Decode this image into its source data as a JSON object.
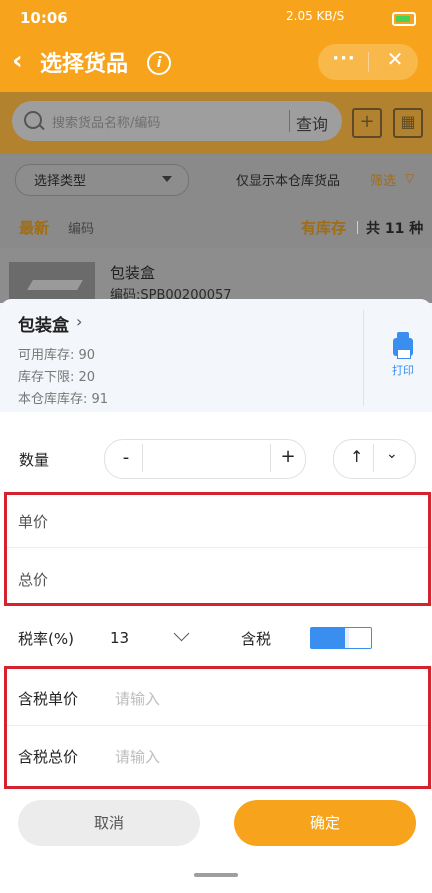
{
  "status_bar": {
    "time": "10:06",
    "network": "2.05 KB/S"
  },
  "header": {
    "title": "选择货品",
    "back_icon": "chevron-left-icon",
    "info_icon": "info-icon",
    "more_icon": "more-icon",
    "close_icon": "close-icon"
  },
  "search": {
    "placeholder": "搜索货品名称/编码",
    "button": "查询"
  },
  "filter": {
    "type_select": "选择类型",
    "only_this_warehouse": "仅显示本仓库货品",
    "filter_label": "筛选"
  },
  "sort": {
    "latest": "最新",
    "code": "编码",
    "in_stock": "有库存",
    "count": "共 11 种"
  },
  "product": {
    "name": "包装盒",
    "code": "编码:SPB00200057"
  },
  "sheet": {
    "name": "包装盒",
    "available_stock": "可用库存: 90",
    "stock_min": "库存下限: 20",
    "warehouse_stock": "本仓库库存: 91",
    "print_label": "打印",
    "quantity_label": "数量",
    "minus": "-",
    "plus": "+",
    "unit_price_label": "单价",
    "total_price_label": "总价",
    "tax_rate_label": "税率(%)",
    "tax_rate_value": "13",
    "tax_included_label": "含税",
    "tax_unit_price_label": "含税单价",
    "tax_unit_price_placeholder": "请输入",
    "tax_total_price_label": "含税总价",
    "tax_total_price_placeholder": "请输入",
    "cancel": "取消",
    "confirm": "确定"
  },
  "colors": {
    "brand": "#f7a31c",
    "accent_blue": "#3a8ef0",
    "highlight_red": "#d4232e"
  }
}
